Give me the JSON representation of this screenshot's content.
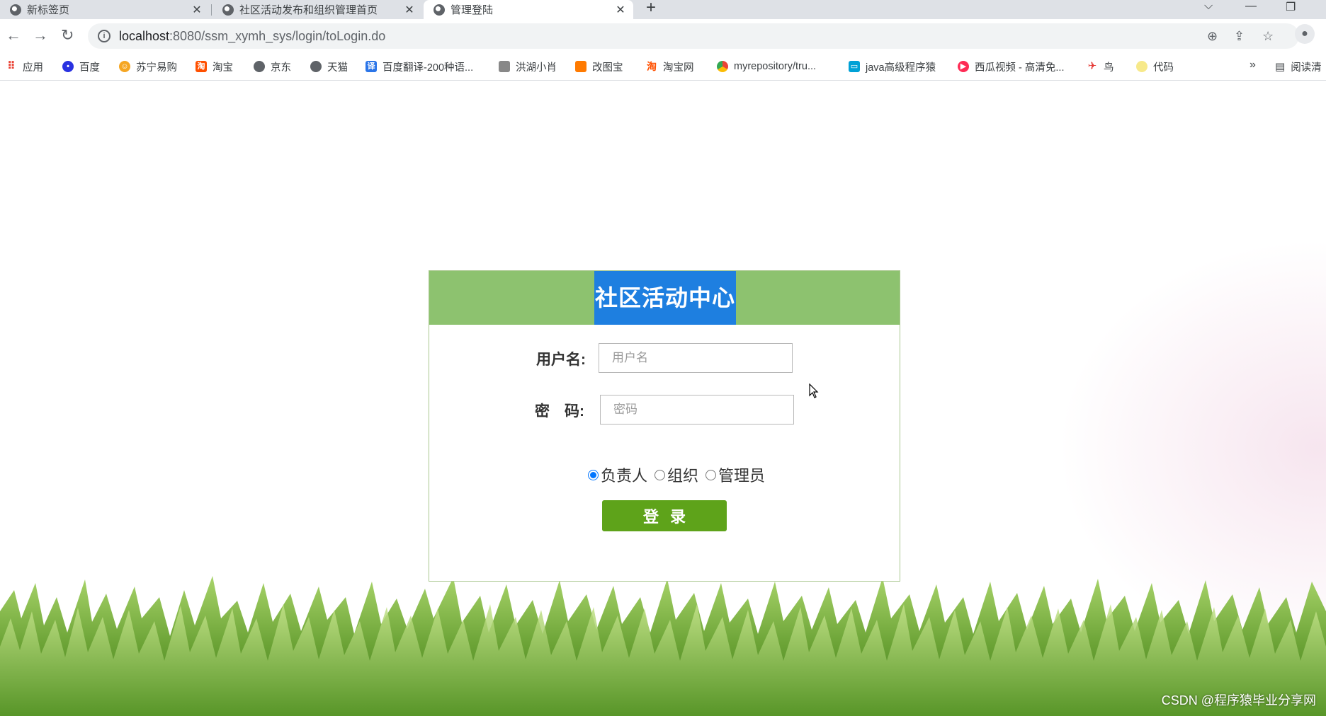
{
  "browser": {
    "tabs": [
      {
        "title": "新标签页",
        "active": false
      },
      {
        "title": "社区活动发布和组织管理首页",
        "active": false
      },
      {
        "title": "管理登陆",
        "active": true
      }
    ],
    "url_host": "localhost",
    "url_path": ":8080/ssm_xymh_sys/login/toLogin.do",
    "bookmarks": [
      {
        "label": "应用",
        "icon": "apps-grid-icon",
        "color": "#ea4335"
      },
      {
        "label": "百度",
        "icon": "baidu-paw-icon",
        "color": "#2932e1"
      },
      {
        "label": "苏宁易购",
        "icon": "suning-icon",
        "color": "#f5a623"
      },
      {
        "label": "淘宝",
        "icon": "taobao-icon",
        "color": "#ff5000"
      },
      {
        "label": "京东",
        "icon": "globe-icon",
        "color": "#5f6368"
      },
      {
        "label": "天猫",
        "icon": "globe-icon",
        "color": "#5f6368"
      },
      {
        "label": "百度翻译-200种语...",
        "icon": "translate-icon",
        "color": "#2b75e8"
      },
      {
        "label": "洪湖小肖",
        "icon": "hongh-icon",
        "color": "#888888"
      },
      {
        "label": "改图宝",
        "icon": "gaitubao-icon",
        "color": "#ff7a00"
      },
      {
        "label": "淘宝网",
        "icon": "taobao-icon",
        "color": "#ff5000"
      },
      {
        "label": "myrepository/tru...",
        "icon": "chrome-icon",
        "color": "#34a853"
      },
      {
        "label": "java高级程序猿",
        "icon": "bilibili-icon",
        "color": "#00a1d6"
      },
      {
        "label": "西瓜视频 - 高清免...",
        "icon": "xigua-icon",
        "color": "#fe2c55"
      },
      {
        "label": "鸟",
        "icon": "bird-icon",
        "color": "#e53935"
      },
      {
        "label": "代码",
        "icon": "code-icon",
        "color": "#f7df1e"
      }
    ],
    "more_bookmarks": "»",
    "reading_list": "阅读清"
  },
  "login": {
    "title": "社区活动中心",
    "username_label": "用户名:",
    "username_placeholder": "用户名",
    "password_label": "密　码:",
    "password_placeholder": "密码",
    "roles": [
      {
        "label": "负责人",
        "checked": true
      },
      {
        "label": "组织",
        "checked": false
      },
      {
        "label": "管理员",
        "checked": false
      }
    ],
    "submit_label": "登录"
  },
  "watermark": "CSDN @程序猿毕业分享网",
  "colors": {
    "header_green": "#8dc26f",
    "title_highlight": "#1e7fe0",
    "button_green": "#5ea31a"
  }
}
